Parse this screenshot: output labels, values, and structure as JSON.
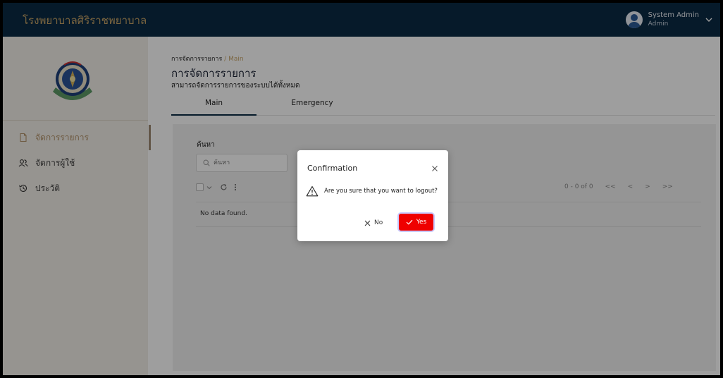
{
  "app": {
    "brand": "โรงพยาบาลศิริราชพยาบาล"
  },
  "user": {
    "name": "System Admin",
    "role": "Admin"
  },
  "sidebar": {
    "items": [
      {
        "label": "จัดการรายการ",
        "icon": "document-icon",
        "active": true
      },
      {
        "label": "จัดการผู้ใช้",
        "icon": "users-icon",
        "active": false
      },
      {
        "label": "ประวัติ",
        "icon": "history-icon",
        "active": false
      }
    ]
  },
  "main": {
    "breadcrumb": {
      "root": "การจัดการรายการ",
      "separator": "/",
      "current": "Main"
    },
    "title": "การจัดการรายการ",
    "subtitle": "สามารถจัดการรายการของระบบได้ทั้งหมด",
    "tabs": [
      {
        "label": "Main",
        "active": true
      },
      {
        "label": "Emergency",
        "active": false
      }
    ],
    "search": {
      "label": "ค้นหา",
      "placeholder": "ค้นหา"
    },
    "pager": {
      "range": "0 - 0 of 0",
      "first": "<<",
      "prev": "<",
      "next": ">",
      "last": ">>"
    },
    "empty_text": "No data found."
  },
  "dialog": {
    "title": "Confirmation",
    "message": "Are you sure that you want to logout?",
    "no_label": "No",
    "yes_label": "Yes"
  },
  "colors": {
    "header": "#0b2a45",
    "brand_text": "#c7a466",
    "sidebar_bg": "#f3efe8",
    "yes_button": "#ef0000"
  }
}
